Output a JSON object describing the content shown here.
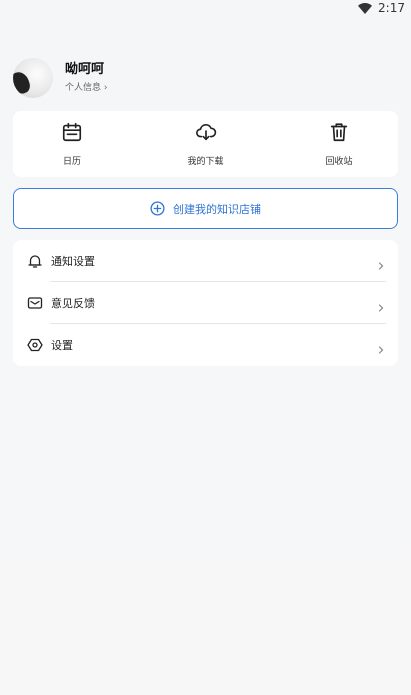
{
  "status_bar": {
    "time": "2:17"
  },
  "profile": {
    "username": "呦呵呵",
    "link_label": "个人信息 ›"
  },
  "quick_actions": [
    {
      "label": "日历",
      "icon": "calendar-icon"
    },
    {
      "label": "我的下载",
      "icon": "download-cloud-icon"
    },
    {
      "label": "回收站",
      "icon": "trash-icon"
    }
  ],
  "create_button": {
    "label": "创建我的知识店铺",
    "icon": "plus-circle-icon",
    "accent": "#2f74d6"
  },
  "menu": [
    {
      "label": "通知设置",
      "icon": "bell-icon"
    },
    {
      "label": "意见反馈",
      "icon": "mail-icon"
    },
    {
      "label": "设置",
      "icon": "settings-icon"
    }
  ]
}
